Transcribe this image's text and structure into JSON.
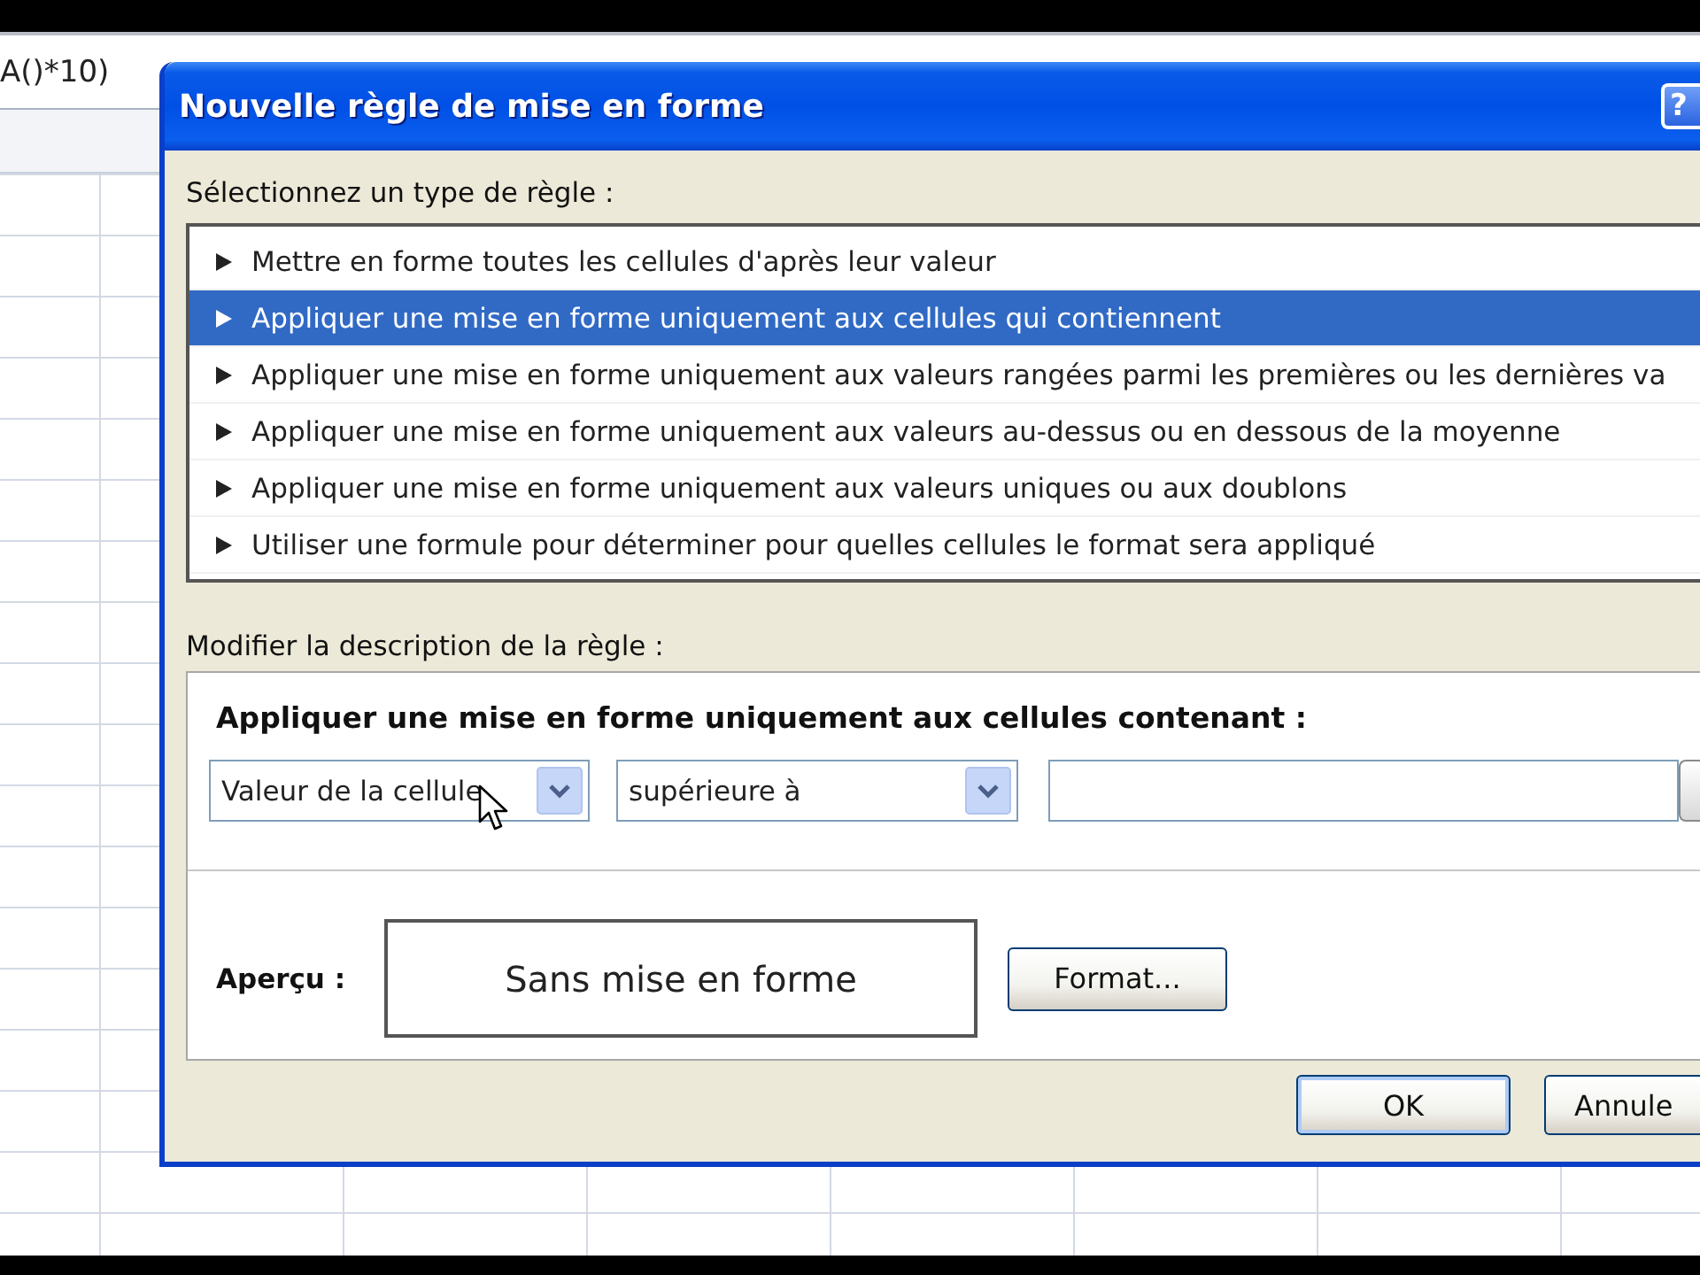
{
  "spreadsheet": {
    "formula": "A()*10)"
  },
  "dialog": {
    "title": "Nouvelle règle de mise en forme",
    "help_button": "?",
    "rule_type_label": "Sélectionnez un type de règle :",
    "rule_types": [
      {
        "label": "Mettre en forme toutes les cellules d'après leur valeur",
        "selected": false
      },
      {
        "label": "Appliquer une mise en forme uniquement aux cellules qui contiennent",
        "selected": true
      },
      {
        "label": "Appliquer une mise en forme uniquement aux valeurs rangées parmi les premières ou les dernières va",
        "selected": false
      },
      {
        "label": "Appliquer une mise en forme uniquement aux valeurs au-dessus ou en dessous de la moyenne",
        "selected": false
      },
      {
        "label": "Appliquer une mise en forme uniquement aux valeurs uniques ou aux doublons",
        "selected": false
      },
      {
        "label": "Utiliser une formule pour déterminer pour quelles cellules le format sera appliqué",
        "selected": false
      }
    ],
    "description_label": "Modifier la description de la règle :",
    "description": {
      "heading": "Appliquer une mise en forme uniquement aux cellules contenant :",
      "condition_field": "Valeur de la cellule",
      "operator": "supérieure à",
      "preview_label": "Aperçu :",
      "preview": "Sans mise en forme",
      "format_button": "Format..."
    },
    "buttons": [
      {
        "label": "OK",
        "kind": "ok"
      },
      {
        "label": "Annule",
        "kind": "cancel"
      }
    ]
  }
}
